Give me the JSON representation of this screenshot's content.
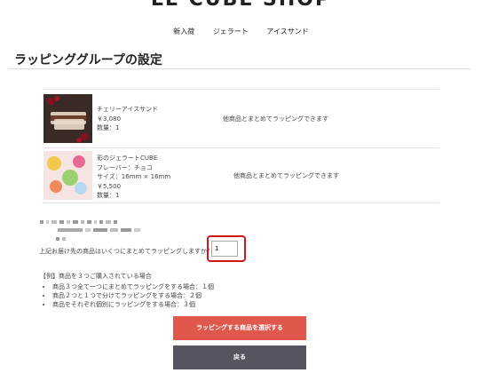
{
  "header": {
    "shop_name": "LE CUBE SHOP",
    "nav": [
      "新入荷",
      "ジェラート",
      "アイスサンド"
    ]
  },
  "page_title": "ラッピンググループの設定",
  "products": [
    {
      "name": "チェリーアイスサンド",
      "price": "￥3,080",
      "quantity": "数量：1",
      "note": "他商品とまとめてラッピングできます"
    },
    {
      "name": "彩のジェラートCUBE",
      "flavor": "フレーバー：チョコ",
      "size": "サイズ：16mm × 16mm",
      "price": "￥5,500",
      "quantity": "数量：1",
      "note": "他商品とまとめてラッピングできます"
    }
  ],
  "question": "上記お届け先の商品はいくつにまとめてラッピングしますか？",
  "count_value": "1",
  "example": {
    "heading": "【例】商品を３つご購入されている場合",
    "items": [
      "商品３つ全て一つにまとめてラッピングをする場合：１個",
      "商品２つと１つで分けてラッピングをする場合：２個",
      "商品をそれぞれ個別にラッピングをする場合：３個"
    ]
  },
  "buttons": {
    "select": "ラッピングする商品を選択する",
    "back": "戻る"
  },
  "colors": {
    "select_button": "#e0584c",
    "back_button": "#55555f",
    "highlight": "#d01818"
  }
}
